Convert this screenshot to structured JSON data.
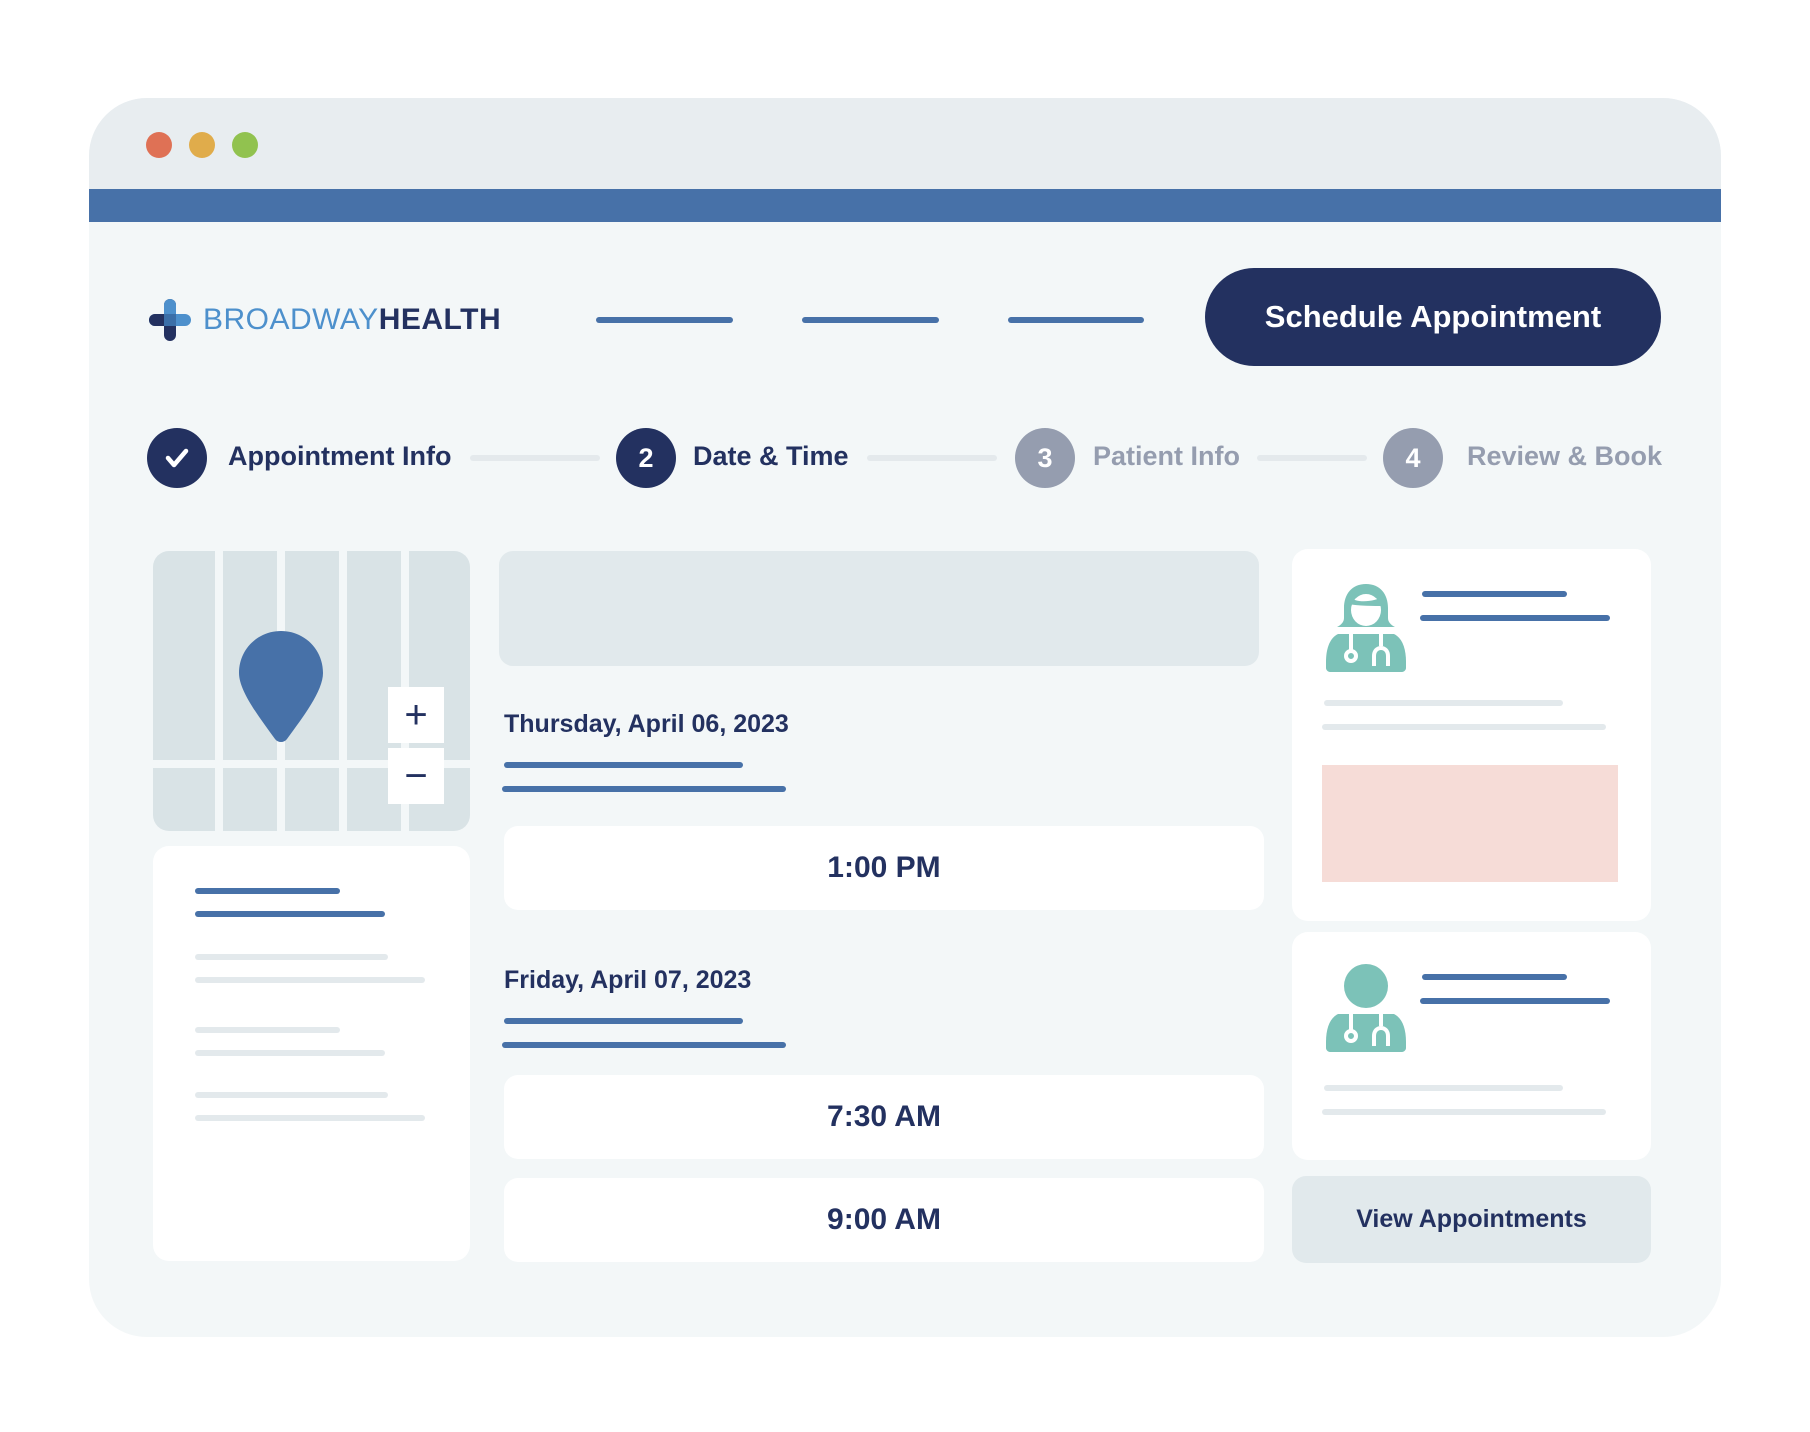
{
  "window": {
    "traffic_lights": [
      {
        "name": "close",
        "color": "#df7155"
      },
      {
        "name": "minimize",
        "color": "#e0ac4b"
      },
      {
        "name": "maximize",
        "color": "#91c24f"
      }
    ],
    "accent_color": "#4771a8"
  },
  "header": {
    "logo": {
      "part1": "BROADWAY",
      "part2": "HEALTH"
    },
    "nav_placeholder_count": 3,
    "cta_label": "Schedule Appointment"
  },
  "stepper": {
    "steps": [
      {
        "number": "✓",
        "label": "Appointment Info",
        "state": "completed"
      },
      {
        "number": "2",
        "label": "Date & Time",
        "state": "current"
      },
      {
        "number": "3",
        "label": "Patient Info",
        "state": "pending"
      },
      {
        "number": "4",
        "label": "Review & Book",
        "state": "pending"
      }
    ]
  },
  "map": {
    "zoom_in_label": "+",
    "zoom_out_label": "−"
  },
  "schedule": {
    "days": [
      {
        "date": "Thursday, April 06, 2023",
        "slots": [
          "1:00 PM"
        ]
      },
      {
        "date": "Friday, April 07, 2023",
        "slots": [
          "7:30 AM",
          "9:00 AM"
        ]
      }
    ]
  },
  "providers": [
    {
      "icon": "female-doctor-icon",
      "has_highlight_block": true
    },
    {
      "icon": "male-doctor-icon",
      "has_highlight_block": false
    }
  ],
  "actions": {
    "view_appointments_label": "View Appointments"
  },
  "colors": {
    "navy": "#233160",
    "blue": "#4771a8",
    "teal": "#7cc2b8",
    "muted": "#959daf",
    "pink": "#f6dcd7"
  }
}
